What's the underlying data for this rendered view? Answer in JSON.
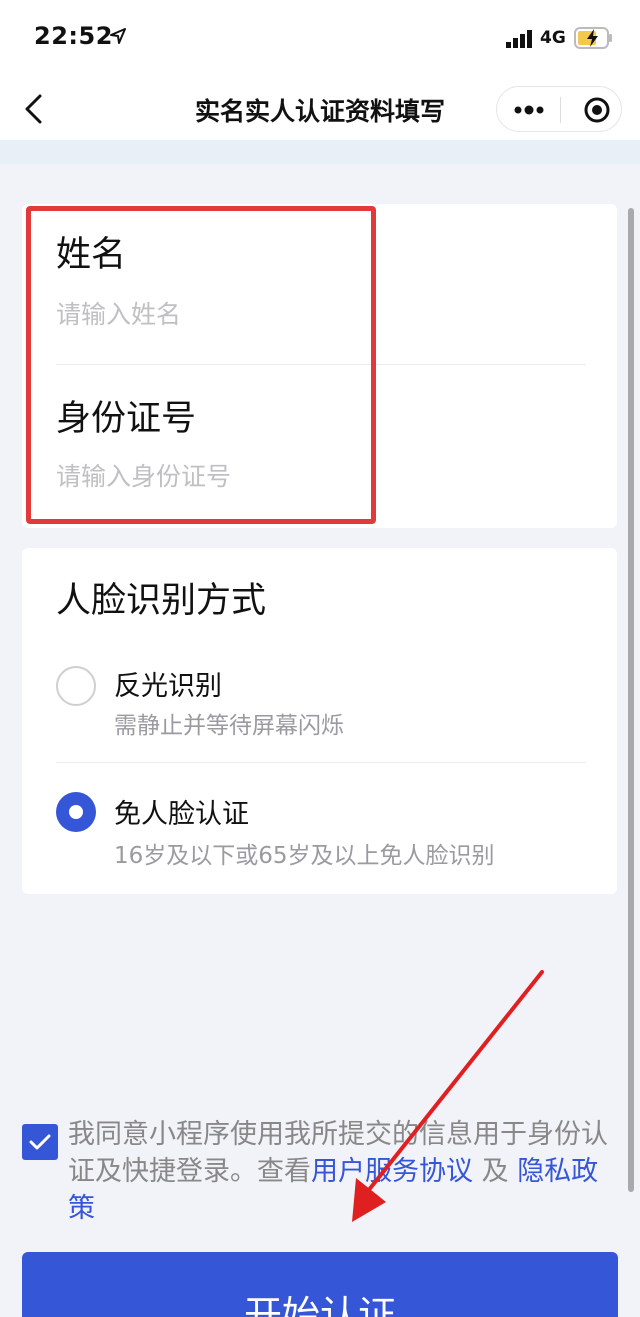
{
  "status_bar": {
    "time": "22:52",
    "network": "4G"
  },
  "nav": {
    "title": "实名实人认证资料填写"
  },
  "identity_form": {
    "name_label": "姓名",
    "name_placeholder": "请输入姓名",
    "id_label": "身份证号",
    "id_placeholder": "请输入身份证号"
  },
  "face_section": {
    "title": "人脸识别方式",
    "options": [
      {
        "title": "反光识别",
        "desc": "需静止并等待屏幕闪烁",
        "selected": false
      },
      {
        "title": "免人脸认证",
        "desc": "16岁及以下或65岁及以上免人脸识别",
        "selected": true
      }
    ]
  },
  "agreement": {
    "text_before": "我同意小程序使用我所提交的信息用于身份认证及快捷登录。查看",
    "link_user_agreement": "用户服务协议",
    "conjunction": "及",
    "link_privacy": "隐私政策",
    "checked": true
  },
  "start_button": {
    "label": "开始认证"
  },
  "colors": {
    "primary": "#3656d8",
    "highlight": "#e23a3a",
    "background": "#f1f3f8"
  }
}
